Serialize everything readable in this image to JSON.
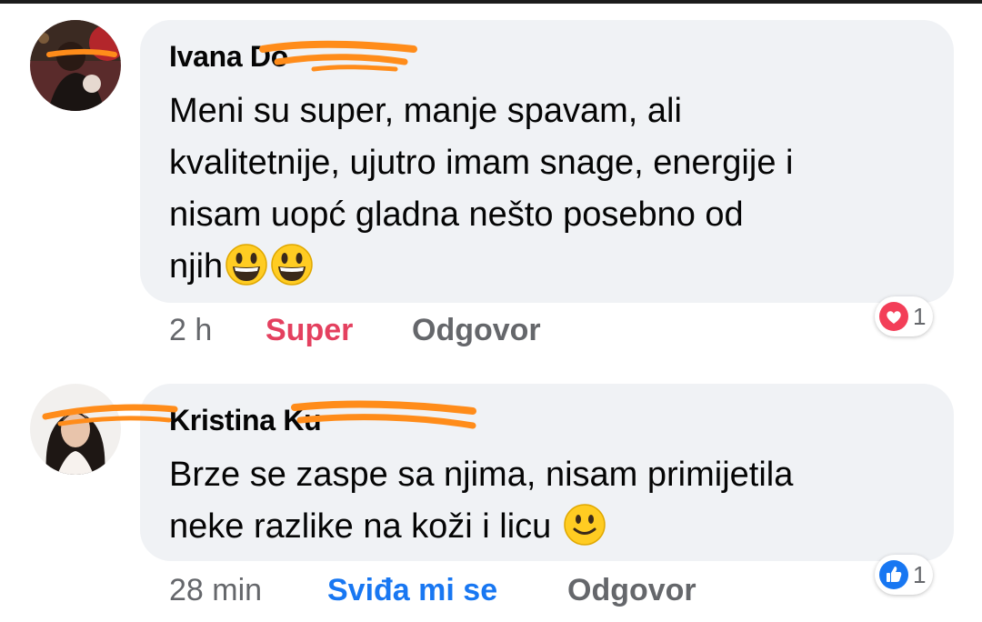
{
  "comments": [
    {
      "author": "Ivana Do",
      "lines": [
        "Meni su super,  manje spavam, ali",
        "kvalitetnije, ujutro imam snage, energije i",
        "nisam uopć gladna nešto posebno od",
        "njih"
      ],
      "emoji": [
        "grinning-face-emoji",
        "grinning-face-emoji"
      ],
      "time": "2 h",
      "reaction_label": "Super",
      "reply_label": "Odgovor",
      "reaction_type": "love",
      "reaction_count": "1"
    },
    {
      "author": "Kristina Ku",
      "lines": [
        "Brze se zaspe sa njima, nisam primijetila",
        "neke razlike na koži i licu"
      ],
      "emoji": [
        "slightly-smiling-face-emoji"
      ],
      "time": "28 min",
      "reaction_label": "Sviđa mi se",
      "reply_label": "Odgovor",
      "reaction_type": "like",
      "reaction_count": "1"
    }
  ],
  "colors": {
    "bubble": "#f0f2f5",
    "love": "#e4405f",
    "like": "#1877f2",
    "meta": "#65676b",
    "redaction": "#ff8c1a"
  }
}
